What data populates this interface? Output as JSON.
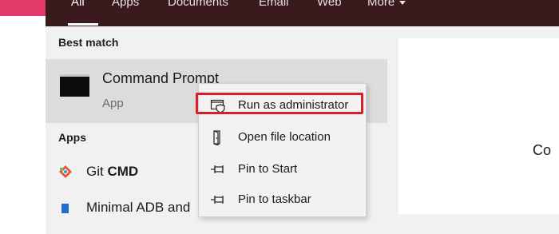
{
  "tabs": [
    {
      "label": "All",
      "active": true
    },
    {
      "label": "Apps",
      "active": false
    },
    {
      "label": "Documents",
      "active": false
    },
    {
      "label": "Email",
      "active": false
    },
    {
      "label": "Web",
      "active": false
    },
    {
      "label": "More",
      "active": false
    }
  ],
  "results": {
    "best_match_heading": "Best match",
    "best_match": {
      "name": "Command Prompt",
      "type": "App",
      "icon": "cmd-icon"
    },
    "apps_heading": "Apps",
    "apps": [
      {
        "name_regular": "Git ",
        "name_bold": "CMD",
        "icon": "git-icon"
      },
      {
        "name_regular": "Minimal ADB and",
        "name_bold": "",
        "icon": "adb-icon"
      }
    ]
  },
  "context_menu": {
    "items": [
      {
        "label": "Run as administrator",
        "icon": "admin-shield-icon",
        "highlighted": true
      },
      {
        "label": "Open file location",
        "icon": "file-location-icon"
      },
      {
        "label": "Pin to Start",
        "icon": "pin-icon"
      },
      {
        "label": "Pin to taskbar",
        "icon": "pin-icon"
      }
    ]
  },
  "preview": {
    "name_partial": "Co"
  },
  "colors": {
    "topbar": "#3b1a1d",
    "highlight": "#d81e28",
    "accent_pink": "#e3386a"
  }
}
